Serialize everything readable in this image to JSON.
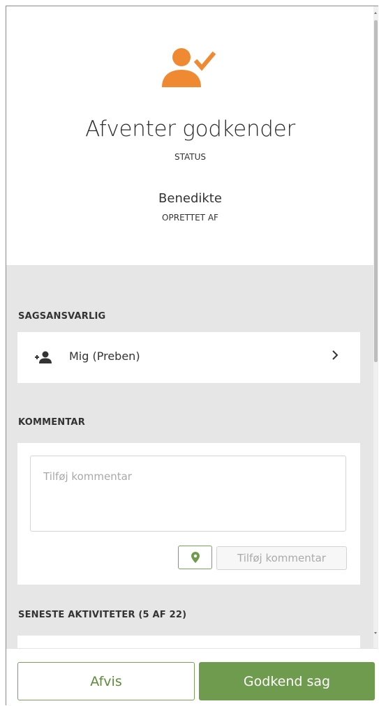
{
  "header": {
    "status_value": "Afventer godkender",
    "status_caption": "STATUS",
    "creator_value": "Benedikte",
    "creator_caption": "OPRETTET AF",
    "icon": "user-check-icon",
    "accent_color": "#f08a32"
  },
  "assignee": {
    "section_label": "SAGSANSVARLIG",
    "value": "Mig (Preben)",
    "icon": "assign-user-icon",
    "chevron_icon": "chevron-right-icon"
  },
  "comment": {
    "section_label": "KOMMENTAR",
    "input_value": "",
    "placeholder": "Tilføj kommentar",
    "location_icon": "location-pin-icon",
    "submit_label": "Tilføj kommentar"
  },
  "activities": {
    "section_label": "SENESTE AKTIVITETER (5 AF 22)"
  },
  "footer": {
    "reject_label": "Afvis",
    "approve_label": "Godkend sag",
    "primary_color": "#6f9b4f"
  }
}
